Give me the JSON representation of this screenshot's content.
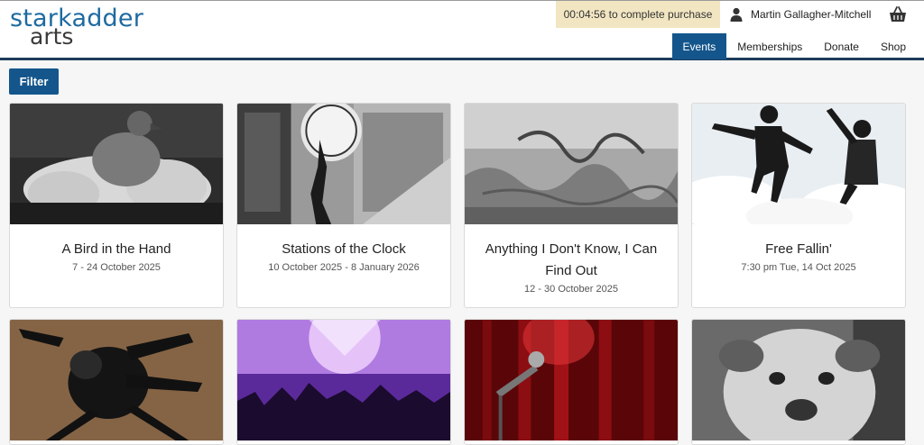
{
  "brand": {
    "line1": "starkadder",
    "line2": "arts"
  },
  "header": {
    "timer_text": "00:04:56 to complete purchase",
    "user_name": "Martin Gallagher-Mitchell"
  },
  "nav": {
    "items": [
      {
        "label": "Events",
        "active": true
      },
      {
        "label": "Memberships",
        "active": false
      },
      {
        "label": "Donate",
        "active": false
      },
      {
        "label": "Shop",
        "active": false
      }
    ]
  },
  "filter": {
    "label": "Filter"
  },
  "events": [
    {
      "title": "A Bird in the Hand",
      "date": "7 - 24 October 2025"
    },
    {
      "title": "Stations of the Clock",
      "date": "10 October 2025 - 8 January 2026"
    },
    {
      "title": "Anything I Don't Know, I Can Find Out",
      "date": "12 - 30 October 2025"
    },
    {
      "title": "Free Fallin'",
      "date": "7:30 pm Tue, 14 Oct 2025"
    }
  ],
  "colors": {
    "brand_blue": "#14568c",
    "logo_blue": "#1e6aa0",
    "timer_bg": "#f2e6c2",
    "nav_border": "#1d3c5a"
  }
}
